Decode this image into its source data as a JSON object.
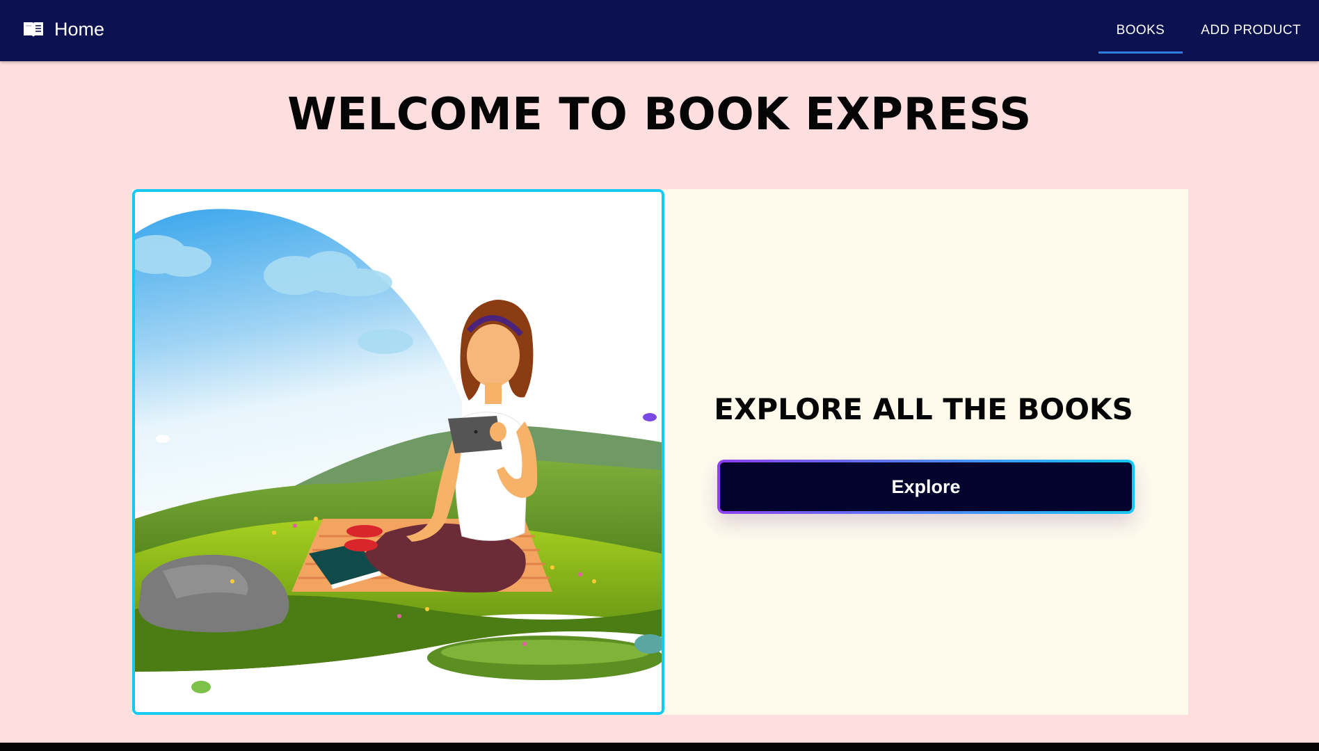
{
  "header": {
    "brand_label": "Home",
    "brand_icon": "open-book-icon",
    "nav": [
      {
        "label": "BOOKS",
        "active": true
      },
      {
        "label": "ADD PRODUCT",
        "active": false
      }
    ]
  },
  "main": {
    "title": "WELCOME TO BOOK EXPRESS",
    "cta_title": "EXPLORE ALL THE BOOKS",
    "explore_label": "Explore"
  },
  "colors": {
    "navbar": "#0b124f",
    "background": "#ffdee0",
    "card": "#fefaec",
    "image_border": "#16c8f4",
    "button_fill": "#03042d",
    "button_border_start": "#8e3ff5",
    "button_border_end": "#16c8f4",
    "nav_active_underline": "#2f7de1"
  }
}
